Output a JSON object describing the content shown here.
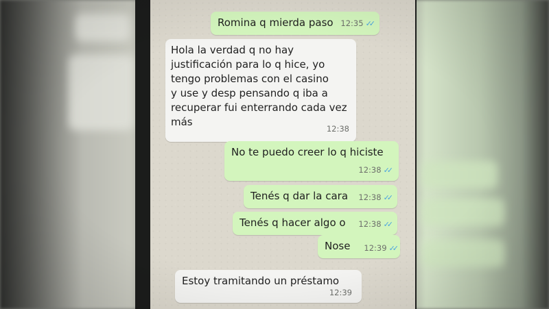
{
  "conversation": {
    "messages": [
      {
        "direction": "outgoing",
        "text": "Romina q mierda paso",
        "time": "12:35",
        "status": "read"
      },
      {
        "direction": "incoming",
        "text": "Hola la verdad q no hay\njustificación para lo q hice, yo\ntengo problemas con el casino\ny use y desp pensando q iba a\nrecuperar fui enterrando cada vez\nmás",
        "time": "12:38"
      },
      {
        "direction": "outgoing",
        "text": "No te puedo creer lo q hiciste",
        "time": "12:38",
        "status": "read"
      },
      {
        "direction": "outgoing",
        "text": "Tenés q dar la cara",
        "time": "12:38",
        "status": "read"
      },
      {
        "direction": "outgoing",
        "text": "Tenés q hacer algo o",
        "time": "12:38",
        "status": "read"
      },
      {
        "direction": "outgoing",
        "text": "Nose",
        "time": "12:39",
        "status": "read"
      },
      {
        "direction": "incoming",
        "text": "Estoy tramitando un préstamo",
        "time": "12:39"
      }
    ],
    "read_tick_icon": "double-check-icon",
    "colors": {
      "outgoing_bubble": "#d3f5bd",
      "incoming_bubble": "#f4f4f2",
      "read_ticks": "#4aa3e0",
      "chat_background": "#dcd8cd"
    }
  }
}
